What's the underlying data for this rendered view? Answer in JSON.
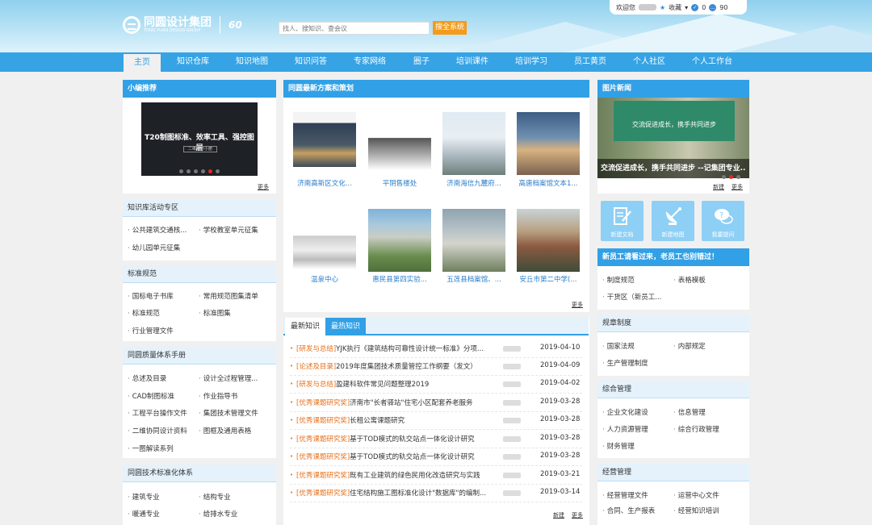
{
  "header": {
    "search_placeholder": "找人、搜知识、查会议",
    "search_button": "搜全系统",
    "greeting": "欢迎您",
    "favorite": "收藏",
    "count_a": "0",
    "count_b": "90"
  },
  "nav": [
    "主页",
    "知识仓库",
    "知识地图",
    "知识问答",
    "专家网络",
    "圈子",
    "培训课件",
    "培训学习",
    "员工黄页",
    "个人社区",
    "个人工作台"
  ],
  "left": {
    "editor_title": "小编推荐",
    "editor_slide_text": "T20制图标准、效率工具、强控图层",
    "editor_slide_sub": "二维设计小册",
    "more": "更多",
    "sections": [
      {
        "title": "知识库活动专区",
        "items": [
          "公共建筑交通核...",
          "学校教室单元征集",
          "幼儿园单元征集"
        ]
      },
      {
        "title": "标准规范",
        "items": [
          "国标电子书库",
          "常用规范图集清单",
          "标准规范",
          "标准图集",
          "行业管理文件"
        ]
      },
      {
        "title": "同圆质量体系手册",
        "items": [
          "总述及目录",
          "设计全过程管理...",
          "CAD制图标准",
          "作业指导书",
          "工程平台操作文件",
          "集团技术管理文件",
          "二维协同设计资料",
          "图框及通用表格",
          "一图解读系列"
        ]
      },
      {
        "title": "同圆技术标准化体系",
        "items": [
          "建筑专业",
          "结构专业",
          "暖通专业",
          "给排水专业"
        ]
      }
    ]
  },
  "center": {
    "plans_title": "同圆最新方案和策划",
    "thumbs": [
      "济南高新区文化...",
      "平阴售楼处",
      "济南海信九麓府...",
      "高唐档案馆文本1...",
      "温泉中心",
      "惠民县第四实验...",
      "五莲县档案馆、...",
      "安丘市第二中学(..."
    ],
    "more": "更多",
    "tab_latest": "最新知识",
    "tab_hot": "最热知识",
    "rows": [
      {
        "cat": "[研发与总结]",
        "title": "YJK执行《建筑结构可靠性设计统一标准》分项...",
        "date": "2019-04-10"
      },
      {
        "cat": "[论述及目录]",
        "title": "2019年度集团技术质量管控工作纲要（发文）",
        "date": "2019-04-09"
      },
      {
        "cat": "[研发与总结]",
        "title": "盈建科软件常见问题整理2019",
        "date": "2019-04-02"
      },
      {
        "cat": "[优秀课题研究奖]",
        "title": "济南市\"长者驿站\"住宅小区配套养老服务",
        "date": "2019-03-28"
      },
      {
        "cat": "[优秀课题研究奖]",
        "title": "长租公寓课题研究",
        "date": "2019-03-28"
      },
      {
        "cat": "[优秀课题研究奖]",
        "title": "基于TOD模式的轨交站点一体化设计研究",
        "date": "2019-03-28"
      },
      {
        "cat": "[优秀课题研究奖]",
        "title": "基于TOD模式的轨交站点一体化设计研究",
        "date": "2019-03-28"
      },
      {
        "cat": "[优秀课题研究奖]",
        "title": "既有工业建筑的绿色民用化改造研究与实践",
        "date": "2019-03-21"
      },
      {
        "cat": "[优秀课题研究奖]",
        "title": "住宅结构施工图标准化设计\"数据库\"的编制...",
        "date": "2019-03-14"
      }
    ],
    "new_label": "新建",
    "more2": "更多"
  },
  "right": {
    "photo_title": "图片新闻",
    "photo_banner": "交流促进成长，携手共同进步",
    "photo_caption": "交流促进成长，携手共同进步 --记集团专业...",
    "new_label": "新建",
    "more": "更多",
    "icons": [
      "新建文档",
      "新建地图",
      "我要提问"
    ],
    "notice": "新员工请看过来，老员工也别错过！",
    "notice_items": [
      "制度规范",
      "表格模板",
      "干货区（新员工..."
    ],
    "sections": [
      {
        "title": "规章制度",
        "items": [
          "国家法规",
          "内部规定",
          "生产管理制度"
        ]
      },
      {
        "title": "综合管理",
        "items": [
          "企业文化建设",
          "信息管理",
          "人力资源管理",
          "综合行政管理",
          "财务管理"
        ]
      },
      {
        "title": "经营管理",
        "items": [
          "经营管理文件",
          "运营中心文件",
          "合同、生产报表",
          "经营知识培训"
        ]
      }
    ]
  },
  "colors": {
    "primary": "#31a0e6",
    "nav": "#36a3e5",
    "accent": "#f49b1b",
    "category": "#e86f18",
    "link": "#2a7dc9"
  }
}
